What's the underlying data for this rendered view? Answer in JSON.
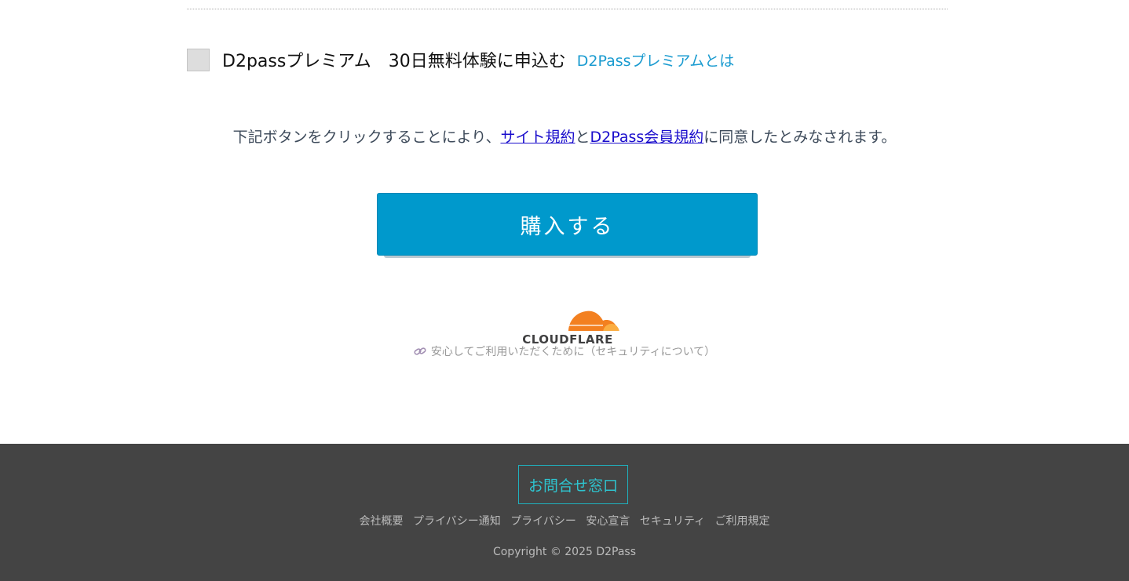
{
  "premium": {
    "checkbox_checked": false,
    "label": "D2passプレミアム　30日無料体験に申込む",
    "info_link": "D2Passプレミアムとは"
  },
  "agreement": {
    "prefix": "下記ボタンをクリックすることにより、",
    "site_terms_link": "サイト規約",
    "conjunction": "と",
    "member_terms_link": "D2Pass会員規約",
    "suffix": "に同意したとみなされます。"
  },
  "purchase": {
    "button_label": "購入する"
  },
  "security": {
    "logo_text": "CLOUDFLARE",
    "link_text": "安心してご利用いただくために（セキュリティについて）"
  },
  "footer": {
    "contact_button": "お問合せ窓口",
    "links": [
      "会社概要",
      "プライバシー通知",
      "プライバシー",
      "安心宣言",
      "セキュリティ",
      "ご利用規定"
    ],
    "copyright": "Copyright © 2025 D2Pass"
  },
  "colors": {
    "accent": "#0099cc",
    "link_blue": "#1a9bd0",
    "footer_bg": "#444444",
    "contact_teal": "#2ec4cf",
    "cloudflare_orange": "#f38020"
  },
  "icons": {
    "link": "link-icon",
    "logo": "cloudflare-cloud-icon"
  }
}
